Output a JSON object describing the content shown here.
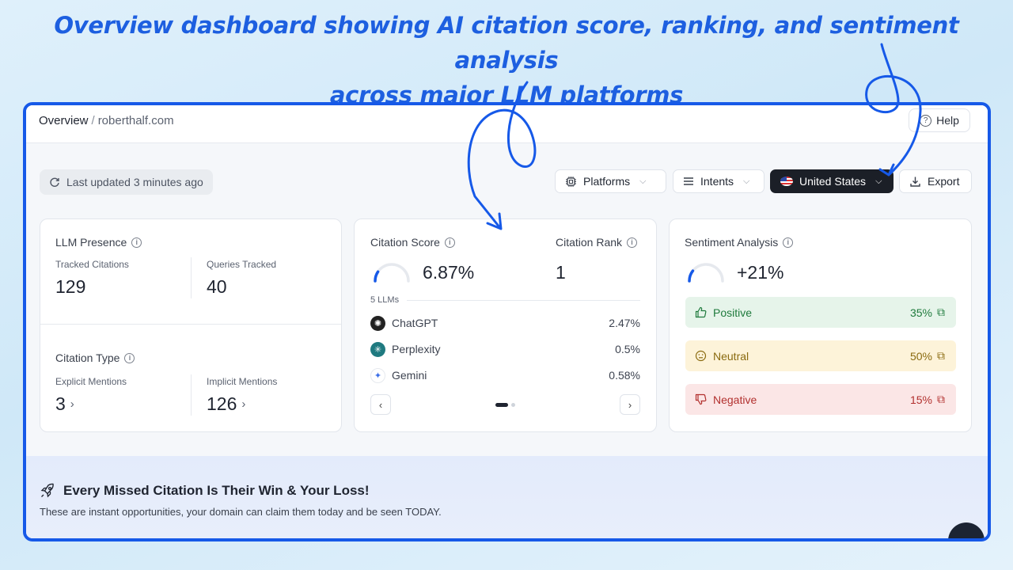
{
  "headline": {
    "line1": "Overview dashboard showing AI citation score, ranking, and sentiment analysis",
    "line2": "across major LLM platforms"
  },
  "breadcrumb": {
    "current": "Overview",
    "separator": "/",
    "domain": "roberthalf.com"
  },
  "help_label": "Help",
  "last_updated": "Last updated 3 minutes ago",
  "toolbar": {
    "platforms_label": "Platforms",
    "intents_label": "Intents",
    "country_label": "United States",
    "export_label": "Export"
  },
  "llm_presence": {
    "title": "LLM Presence",
    "tracked_label": "Tracked Citations",
    "tracked_value": "129",
    "queries_label": "Queries Tracked",
    "queries_value": "40"
  },
  "citation_type": {
    "title": "Citation Type",
    "explicit_label": "Explicit Mentions",
    "explicit_value": "3",
    "implicit_label": "Implicit Mentions",
    "implicit_value": "126"
  },
  "citation_score": {
    "title": "Citation Score",
    "value": "6.87%",
    "gauge_fraction": 0.0687,
    "rank_title": "Citation Rank",
    "rank_value": "1",
    "llm_count": "5 LLMs",
    "llms": [
      {
        "name": "ChatGPT",
        "value": "2.47%",
        "icon": "chatgpt-logo"
      },
      {
        "name": "Perplexity",
        "value": "0.5%",
        "icon": "perplexity-logo"
      },
      {
        "name": "Gemini",
        "value": "0.58%",
        "icon": "gemini-logo"
      }
    ]
  },
  "sentiment": {
    "title": "Sentiment Analysis",
    "value": "+21%",
    "gauge_fraction": 0.21,
    "rows": [
      {
        "label": "Positive",
        "value": "35%",
        "icon": "thumbs-up-icon"
      },
      {
        "label": "Neutral",
        "value": "50%",
        "icon": "neutral-face-icon"
      },
      {
        "label": "Negative",
        "value": "15%",
        "icon": "thumbs-down-icon"
      }
    ]
  },
  "banner": {
    "title": "Every Missed Citation Is Their Win & Your Loss!",
    "subtitle": "These are instant opportunities, your domain can claim them today and be seen TODAY."
  },
  "colors": {
    "accent": "#1659e8",
    "headline": "#1d5fe0",
    "gauge": "#1659e8",
    "positive": "#1e7a3c",
    "neutral": "#8a6a0f",
    "negative": "#b2302e"
  }
}
